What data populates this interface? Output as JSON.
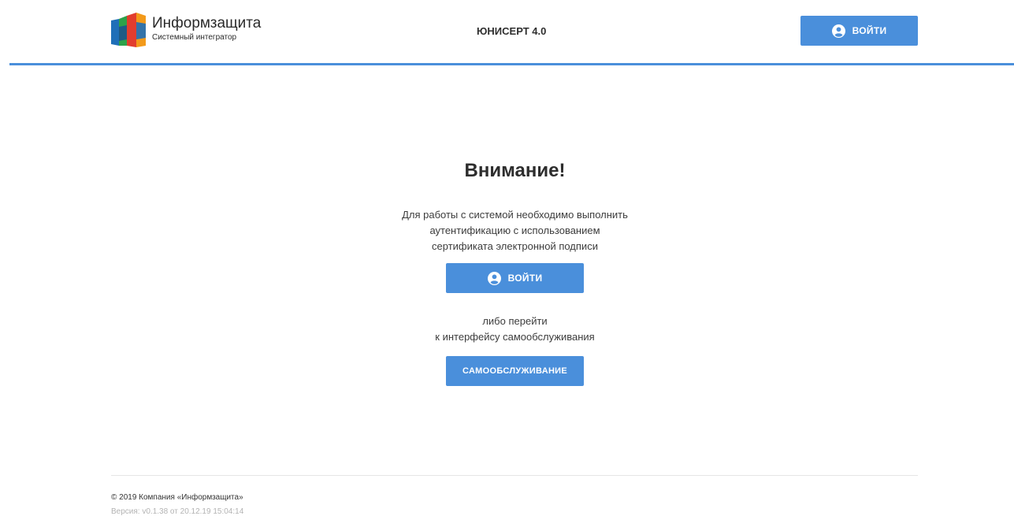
{
  "header": {
    "logo": {
      "title": "Информзащита",
      "subtitle": "Системный интегратор",
      "colors": [
        "#e23d2e",
        "#f39a1a",
        "#2da14a",
        "#1f6fb8"
      ]
    },
    "app_title": "ЮНИСЕРТ 4.0",
    "login_label": "ВОЙТИ",
    "accent_color": "#4a8fdb"
  },
  "main": {
    "heading": "Внимание!",
    "message_lines": [
      "Для работы с системой необходимо выполнить",
      "аутентификацию с использованием",
      "сертификата электронной подписи"
    ],
    "login_label": "ВОЙТИ",
    "alt_lines": [
      "либо перейти",
      "к интерфейсу самообслуживания"
    ],
    "self_service_label": "САМООБСЛУЖИВАНИЕ"
  },
  "footer": {
    "copyright": "© 2019 Компания «Информзащита»",
    "version": "Версия: v0.1.38 от 20.12.19 15:04:14"
  },
  "icons": {
    "login": "user-circle-icon",
    "logo": "informzaschita-logo-icon"
  }
}
